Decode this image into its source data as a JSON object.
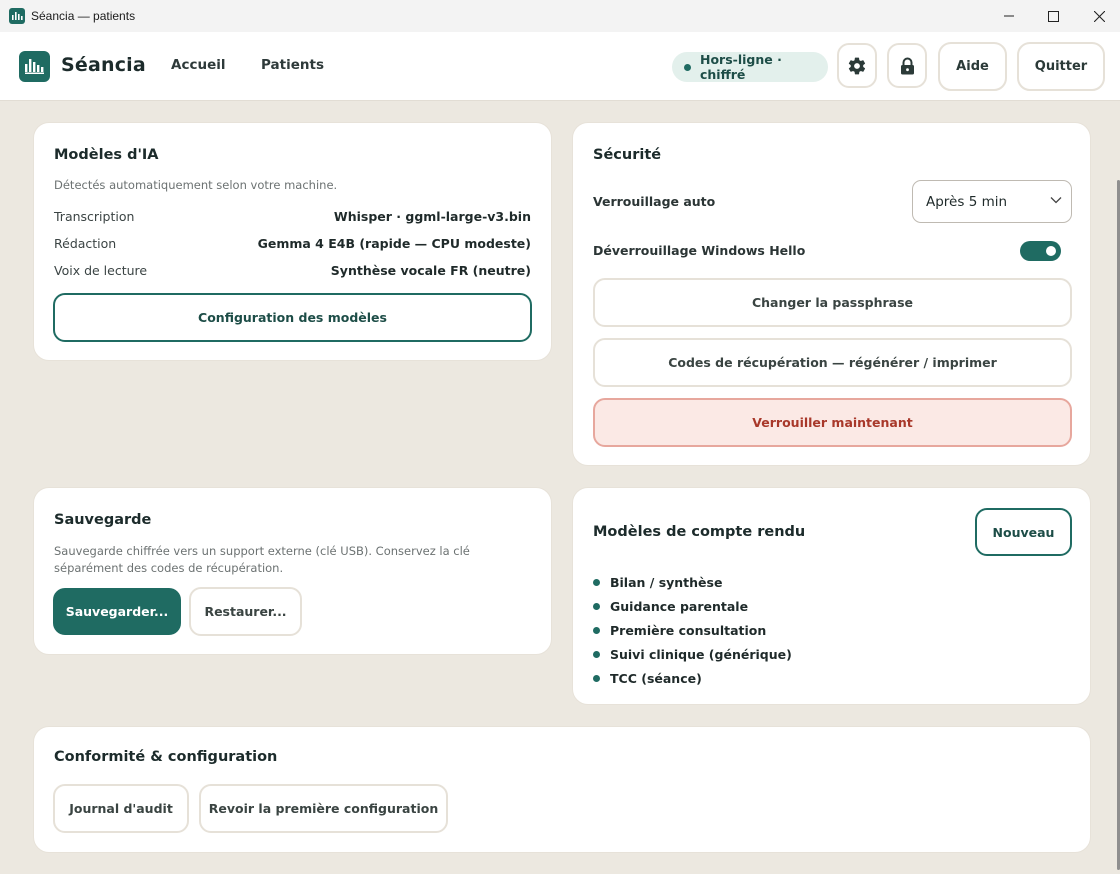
{
  "window": {
    "title": "Séancia — patients"
  },
  "header": {
    "brand": "Séancia",
    "nav": {
      "home": "Accueil",
      "patients": "Patients"
    },
    "status": "Hors-ligne · chiffré",
    "help": "Aide",
    "quit": "Quitter",
    "icons": {
      "settings": "gear-icon",
      "lock": "lock-icon",
      "logo": "waveform-icon"
    }
  },
  "ai_models": {
    "title": "Modèles d'IA",
    "subtitle": "Détectés automatiquement selon votre machine.",
    "rows": [
      {
        "label": "Transcription",
        "value": "Whisper · ggml-large-v3.bin"
      },
      {
        "label": "Rédaction",
        "value": "Gemma 4 E4B (rapide — CPU modeste)"
      },
      {
        "label": "Voix de lecture",
        "value": "Synthèse vocale FR (neutre)"
      }
    ],
    "config_button": "Configuration des modèles"
  },
  "security": {
    "title": "Sécurité",
    "autolock_label": "Verrouillage auto",
    "autolock_value": "Après 5 min",
    "hello_label": "Déverrouillage Windows Hello",
    "hello_enabled": true,
    "change_passphrase": "Changer la passphrase",
    "recovery_codes": "Codes de récupération — régénérer / imprimer",
    "lock_now": "Verrouiller maintenant"
  },
  "backup": {
    "title": "Sauvegarde",
    "description": "Sauvegarde chiffrée vers un support externe (clé USB). Conservez la clé séparément des codes de récupération.",
    "save_button": "Sauvegarder...",
    "restore_button": "Restaurer..."
  },
  "templates": {
    "title": "Modèles de compte rendu",
    "new_button": "Nouveau",
    "items": [
      "Bilan / synthèse",
      "Guidance parentale",
      "Première consultation",
      "Suivi clinique (générique)",
      "TCC (séance)"
    ]
  },
  "compliance": {
    "title": "Conformité & configuration",
    "audit_button": "Journal d'audit",
    "review_button": "Revoir la première configuration"
  },
  "colors": {
    "accent": "#1f6b62",
    "background": "#ece8e0",
    "danger": "#a8382a"
  }
}
